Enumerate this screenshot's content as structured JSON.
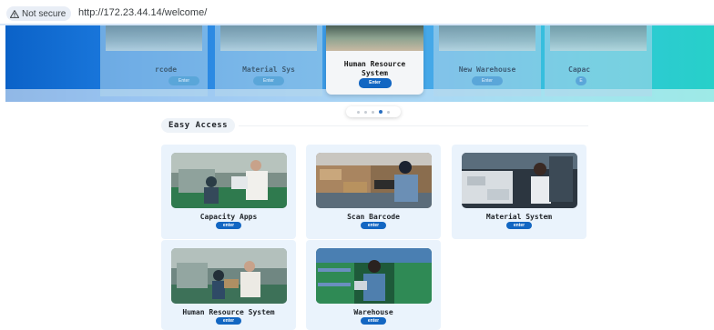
{
  "browser": {
    "security_label": "Not secure",
    "url": "http://172.23.44.14/welcome/"
  },
  "carousel": {
    "slides": [
      {
        "title": "rcode",
        "button": "Enter"
      },
      {
        "title": "Material Sys",
        "button": "Enter"
      },
      {
        "title": "Human Resource System",
        "button": "Enter"
      },
      {
        "title": "New Warehouse",
        "button": "Enter"
      },
      {
        "title": "Capac",
        "button": "E"
      }
    ],
    "active_index": 2,
    "dot_count": 5,
    "active_dot": 3
  },
  "easy_access": {
    "title": "Easy Access",
    "cards": [
      {
        "title": "Capacity Apps",
        "button": "enter"
      },
      {
        "title": "Scan Barcode",
        "button": "enter"
      },
      {
        "title": "Material System",
        "button": "enter"
      },
      {
        "title": "Human Resource System",
        "button": "enter"
      },
      {
        "title": "Warehouse",
        "button": "enter"
      }
    ]
  },
  "colors": {
    "accent": "#1266c2",
    "card_bg": "#eaf3fc",
    "banner_start": "#0b62c8",
    "banner_end": "#27d0c9"
  }
}
